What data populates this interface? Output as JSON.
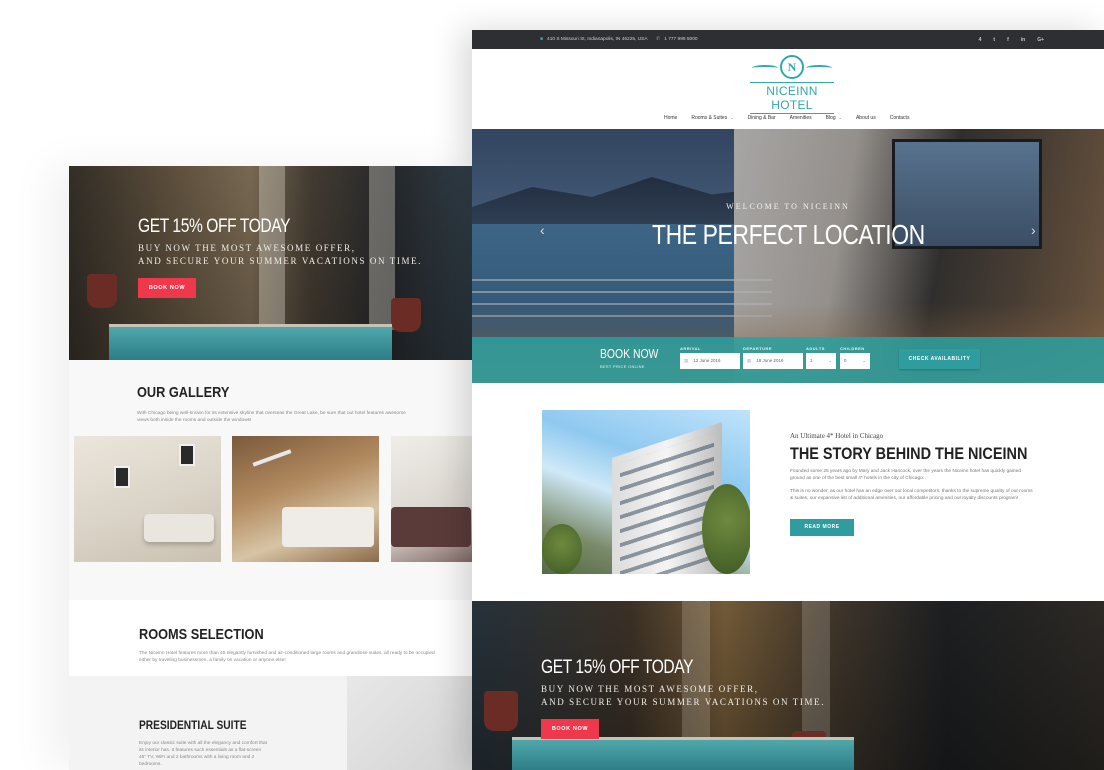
{
  "back_page": {
    "promo": {
      "title": "GET 15% OFF TODAY",
      "subtitle_line1": "BUY NOW THE MOST AWESOME OFFER,",
      "subtitle_line2": "AND SECURE YOUR SUMMER VACATIONS ON TIME.",
      "button": "BOOK NOW"
    },
    "gallery": {
      "title": "OUR GALLERY",
      "text": "With Chicago being well-known for its extensive skyline that overseas the Great Lake, be sure that out hotel features awesome views both inside the rooms and outside the windows!"
    },
    "rooms": {
      "title": "ROOMS SELECTION",
      "text": "The Niceinn Hotel features more than 45 elegantly furnished and air-conditioned large rooms and grandiose suites, all ready to be occupied either by traveling businessmen, a family on vacation or anyone else!",
      "suite_title": "PRESIDENTIAL SUITE",
      "suite_text": "Enjoy our classic suite with all the elegancy and comfort that its interior has. It features such essentials as a flat-screen 45\" TV, WiFi and 2 bathrooms with a living room and 2 bedrooms."
    }
  },
  "topbar": {
    "address": "410 S Missouri St, Indianapolis, IN 46225, USA",
    "phone": "1 777 999 5000",
    "socials": [
      "4",
      "t",
      "f",
      "in",
      "G+"
    ]
  },
  "logo": {
    "emblem": "N",
    "name": "NICEINN HOTEL"
  },
  "nav": {
    "items": [
      "Home",
      "Rooms & Suites",
      "Dining & Bar",
      "Amenities",
      "Blog",
      "About us",
      "Contacts"
    ]
  },
  "hero": {
    "kicker": "WELCOME TO NICEINN",
    "title": "THE PERFECT LOCATION",
    "prev": "‹",
    "next": "›"
  },
  "booking": {
    "title": "BOOK NOW",
    "subtitle": "BEST PRICE ONLINE",
    "arrival_label": "ARRIVAL",
    "arrival_value": "12 June 2016",
    "departure_label": "DEPARTURE",
    "departure_value": "18 June 2016",
    "adults_label": "ADULTS",
    "adults_value": "1",
    "children_label": "CHILDREN",
    "children_value": "0",
    "button": "CHECK AVAILABILITY"
  },
  "story": {
    "kicker": "An Ultimate 4* Hotel in Chicago",
    "title": "THE STORY BEHIND THE NICEINN",
    "para1": "Founded some 25 years ago by Mary and Jack Hancock, over the years the Niceinn hotel has quickly gained ground as one of the best small 4* hotels in the city of Chicago.",
    "para2": "This is no wonder, as our hotel has an edge over our local competitors, thanks to the supreme quality of our rooms & suites, our expansive list of additional amenities, our affordable pricing and our loyalty discounts program!",
    "button": "READ MORE"
  },
  "promo2": {
    "title": "GET 15% OFF TODAY",
    "subtitle_line1": "BUY NOW THE MOST AWESOME OFFER,",
    "subtitle_line2": "AND SECURE YOUR SUMMER VACATIONS ON TIME.",
    "button": "BOOK NOW"
  },
  "colors": {
    "accent_teal": "#2f9d9f",
    "accent_red": "#f0384d",
    "topbar_bg": "#2e2f33"
  }
}
